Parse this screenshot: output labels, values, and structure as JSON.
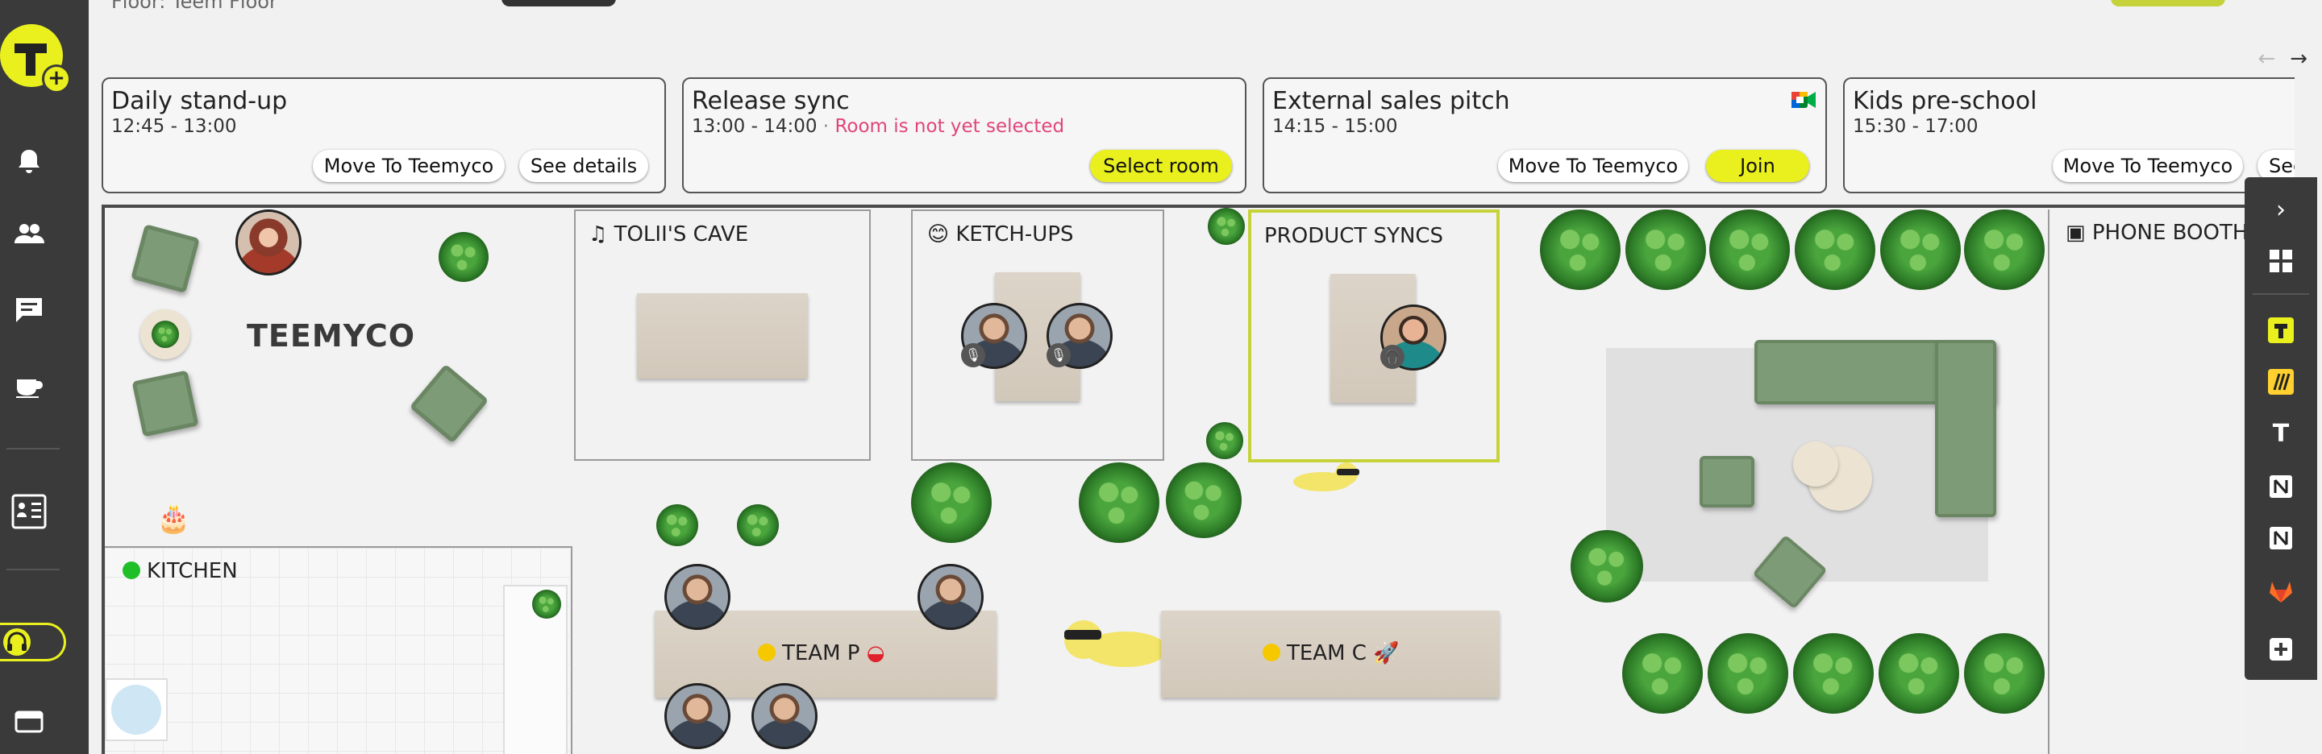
{
  "floor_label": "Floor: Teem Floor",
  "nav": {
    "arrow_left": "←",
    "arrow_right": "→"
  },
  "events": [
    {
      "title": "Daily stand-up",
      "time": "12:45 - 13:00",
      "status": "",
      "buttons": [
        "Move To Teemyco",
        "See details"
      ]
    },
    {
      "title": "Release sync",
      "time": "13:00 - 14:00",
      "status": "Room is not yet selected",
      "buttons": [
        "Select room"
      ]
    },
    {
      "title": "External sales pitch",
      "time": "14:15 - 15:00",
      "status": "",
      "buttons": [
        "Move To Teemyco",
        "Join"
      ]
    },
    {
      "title": "Kids pre-school",
      "time": "15:30 - 17:00",
      "status": "",
      "buttons": [
        "Move To Teemyco",
        "See"
      ]
    }
  ],
  "time_separator": " · ",
  "rooms": {
    "lounge_brand": "TEEMYCO",
    "tolii": "TOLII'S CAVE",
    "ketchups": "KETCH-UPS",
    "product_syncs": "PRODUCT SYNCS",
    "phone_booth": "PHONE BOOTH",
    "kitchen": "KITCHEN",
    "team_p": "TEAM P",
    "team_c": "TEAM C"
  },
  "colors": {
    "accent": "#e9f01e",
    "sidebar": "#3a3a3a",
    "warning_text": "#e0457b",
    "selected_room_border": "#c6d23a",
    "kitchen_status": "#1fbf2a",
    "team_status": "#f5c800"
  },
  "icons": {
    "left_sidebar": [
      "logo-icon",
      "bell-icon",
      "people-icon",
      "chat-icon",
      "coffee-icon",
      "floor-plan-icon",
      "headset-icon",
      "window-icon"
    ],
    "right_sidebar": [
      "chevron-right-icon",
      "apps-grid-icon",
      "teemyco-app-icon",
      "miro-icon",
      "typora-icon",
      "notion-icon",
      "notion-icon",
      "gitlab-icon",
      "add-app-icon"
    ]
  }
}
